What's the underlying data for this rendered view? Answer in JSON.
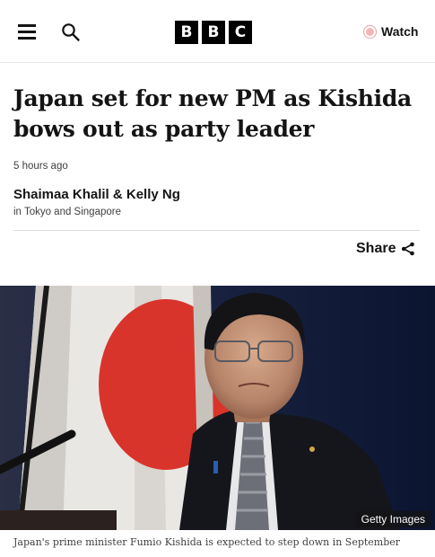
{
  "header": {
    "logo_letters": [
      "B",
      "B",
      "C"
    ],
    "watch_label": "Watch",
    "icons": {
      "menu": "hamburger-menu-icon",
      "search": "search-icon",
      "watch": "live-dot-icon"
    }
  },
  "article": {
    "headline": "Japan set for new PM as Kishida bows out as party leader",
    "timestamp": "5 hours ago",
    "authors": "Shaimaa Khalil & Kelly Ng",
    "location": "in Tokyo and Singapore",
    "share_label": "Share",
    "image": {
      "credit": "Getty Images",
      "caption": "Japan's prime minister Fumio Kishida is expected to step down in September"
    }
  },
  "colors": {
    "text": "#141414",
    "muted": "#3f3f42",
    "logo_bg": "#000000",
    "watch_dot": "#f2b6b6",
    "flag_red": "#d9342b",
    "photo_bg": "#0f1a33"
  }
}
